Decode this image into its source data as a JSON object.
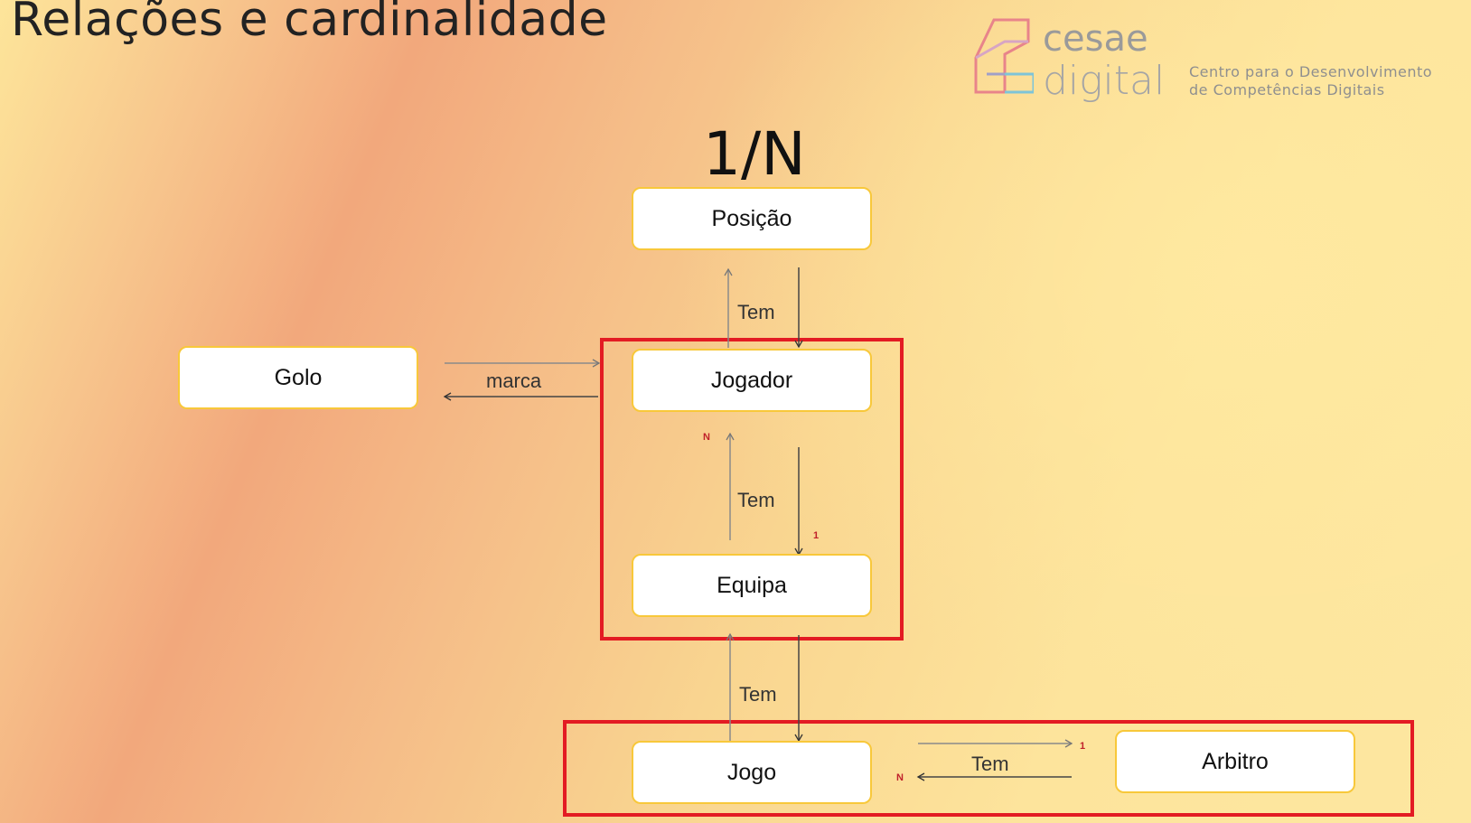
{
  "slide": {
    "title": "Relações e cardinalidade",
    "heading": "1/N"
  },
  "logo": {
    "word1": "cesae",
    "word2": "digital",
    "subtitle_line1": "Centro para o Desenvolvimento",
    "subtitle_line2": "de Competências Digitais"
  },
  "entities": {
    "posicao": "Posição",
    "jogador": "Jogador",
    "golo": "Golo",
    "equipa": "Equipa",
    "jogo": "Jogo",
    "arbitro": "Arbitro"
  },
  "relations": {
    "posicao_jogador": "Tem",
    "golo_jogador": "marca",
    "jogador_equipa": "Tem",
    "equipa_jogo": "Tem",
    "jogo_arbitro": "Tem"
  },
  "cardinalities": {
    "jogador_equipa_n": "N",
    "jogador_equipa_1": "1",
    "jogo_arbitro_1": "1",
    "jogo_arbitro_n": "N"
  },
  "colors": {
    "highlight": "#e31b23",
    "entity_border": "#f8c83a",
    "cardinality": "#c0202a"
  }
}
